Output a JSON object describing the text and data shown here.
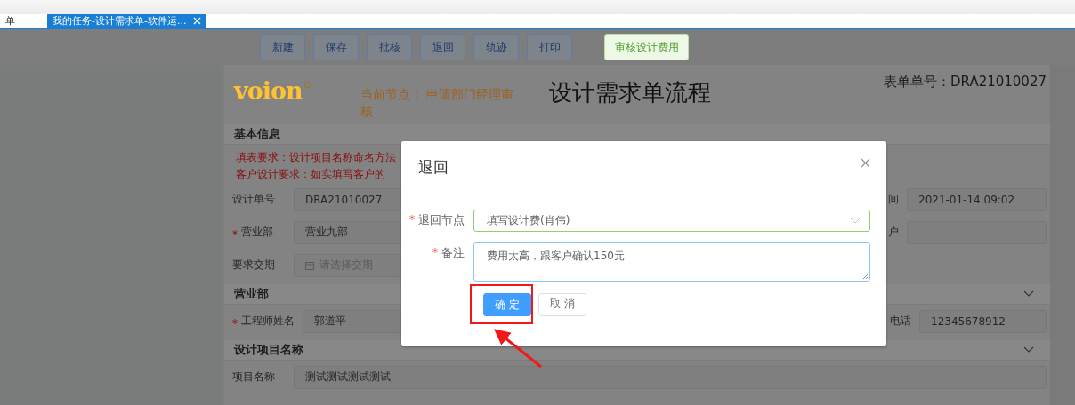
{
  "tabs": [
    {
      "label": "单",
      "selected": false
    },
    {
      "label": "我的任务-设计需求单-软件运...",
      "selected": true
    }
  ],
  "toolbar": [
    {
      "label": "新建",
      "kind": "plain"
    },
    {
      "label": "保存",
      "kind": "plain"
    },
    {
      "label": "批核",
      "kind": "plain"
    },
    {
      "label": "退回",
      "kind": "plain"
    },
    {
      "label": "轨迹",
      "kind": "plain"
    },
    {
      "label": "打印",
      "kind": "plain"
    },
    {
      "label": "审核设计费用",
      "kind": "accent"
    }
  ],
  "header": {
    "logo": "voion",
    "node": "当前节点：  申请部门经理审核",
    "title": "设计需求单流程",
    "form_no": "表单单号：DRA21010027"
  },
  "sections": [
    {
      "title": "基本信息",
      "chevron": false,
      "notes": [
        "填表要求：设计项目名称命名方法",
        "客户设计要求：如实填写客户的"
      ],
      "rows": [
        {
          "left": {
            "label": "设计单号",
            "required": false,
            "kind": "text",
            "value": "DRA21010027"
          },
          "right": {
            "label": "间",
            "value": "2021-01-14 09:02"
          }
        },
        {
          "left": {
            "label": "营业部",
            "required": true,
            "kind": "text",
            "value": "营业九部"
          },
          "right": {
            "label": "户"
          }
        },
        {
          "left": {
            "label": "要求交期",
            "required": false,
            "kind": "date",
            "placeholder": "请选择交期"
          }
        }
      ]
    },
    {
      "title": "营业部",
      "chevron": true,
      "rows": [
        {
          "left": {
            "label": "工程师姓名",
            "required": true,
            "kind": "text",
            "value": "郭道平"
          },
          "right": {
            "label": "电话",
            "value": "12345678912"
          }
        }
      ]
    },
    {
      "title": "设计项目名称",
      "chevron": true,
      "rows": [
        {
          "left": {
            "label": "项目名称",
            "required": false,
            "kind": "text",
            "value": "测试测试测试测试"
          }
        }
      ]
    }
  ],
  "dialog": {
    "title": "退回",
    "fields": [
      {
        "label": "退回节点",
        "required": true,
        "kind": "select",
        "value": "填写设计费(肖伟)"
      },
      {
        "label": "备注",
        "required": true,
        "kind": "textarea",
        "value": "费用太高，跟客户确认150元"
      }
    ],
    "buttons": [
      {
        "label": "确 定",
        "kind": "primary",
        "highlighted": true
      },
      {
        "label": "取 消",
        "kind": "default",
        "highlighted": false
      }
    ]
  }
}
